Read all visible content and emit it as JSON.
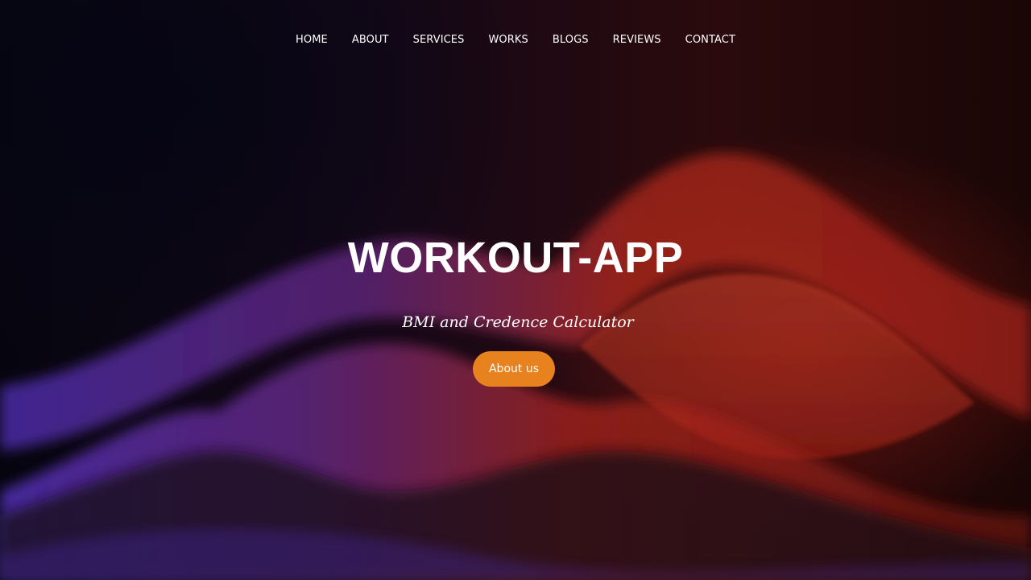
{
  "nav": {
    "items": [
      {
        "label": "HOME"
      },
      {
        "label": "ABOUT"
      },
      {
        "label": "SERVICES"
      },
      {
        "label": "WORKS"
      },
      {
        "label": "BLOGS"
      },
      {
        "label": "REVIEWS"
      },
      {
        "label": "CONTACT"
      }
    ]
  },
  "hero": {
    "title": "WORKOUT-APP",
    "subtitle": "BMI and Credence Calculator",
    "cta_label": "About us"
  },
  "colors": {
    "accent": "#e8821e",
    "background_dark": "#0a0610",
    "wave_purple": "#5a34c8",
    "wave_red": "#c0281e",
    "text": "#ffffff"
  }
}
